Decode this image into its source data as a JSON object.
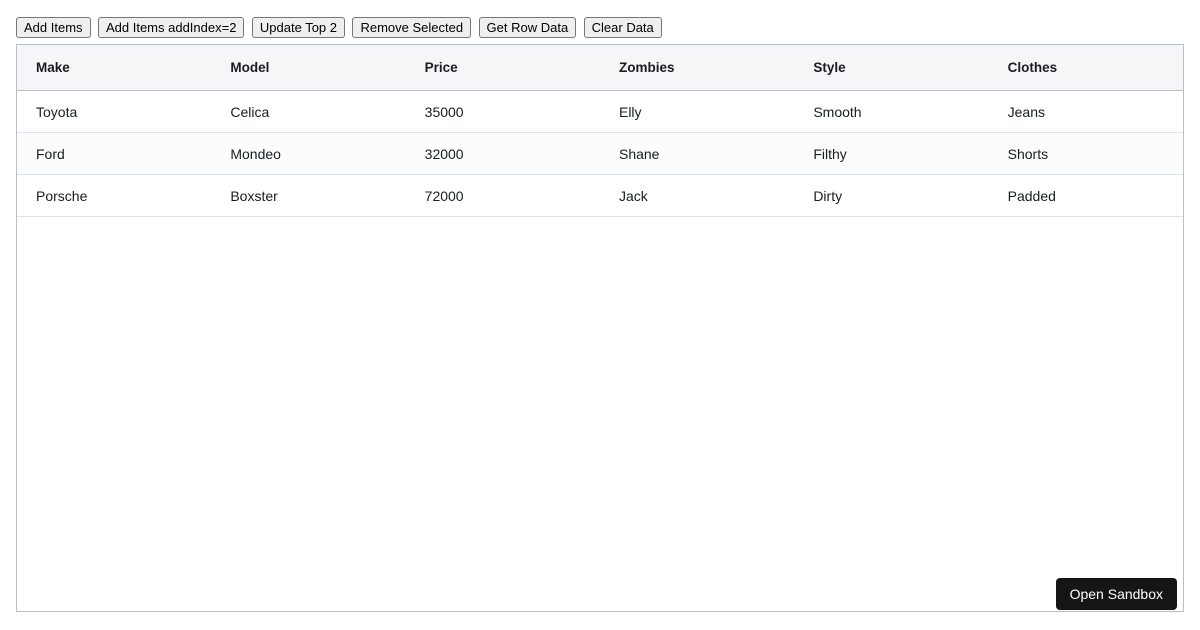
{
  "toolbar": {
    "buttons": [
      "Add Items",
      "Add Items addIndex=2",
      "Update Top 2",
      "Remove Selected",
      "Get Row Data",
      "Clear Data"
    ]
  },
  "grid": {
    "columns": [
      "Make",
      "Model",
      "Price",
      "Zombies",
      "Style",
      "Clothes"
    ],
    "rows": [
      [
        "Toyota",
        "Celica",
        "35000",
        "Elly",
        "Smooth",
        "Jeans"
      ],
      [
        "Ford",
        "Mondeo",
        "32000",
        "Shane",
        "Filthy",
        "Shorts"
      ],
      [
        "Porsche",
        "Boxster",
        "72000",
        "Jack",
        "Dirty",
        "Padded"
      ]
    ]
  },
  "overlay": {
    "open_sandbox_label": "Open Sandbox"
  },
  "colors": {
    "grid_border": "#babfc7",
    "row_border": "#dde2eb",
    "header_bg": "#f5f6f7",
    "odd_row_bg": "#fcfcfc",
    "text": "#181d1f",
    "button_bg": "#efefef",
    "button_border": "#767676",
    "sandbox_bg": "#151515",
    "sandbox_text": "#ffffff"
  }
}
